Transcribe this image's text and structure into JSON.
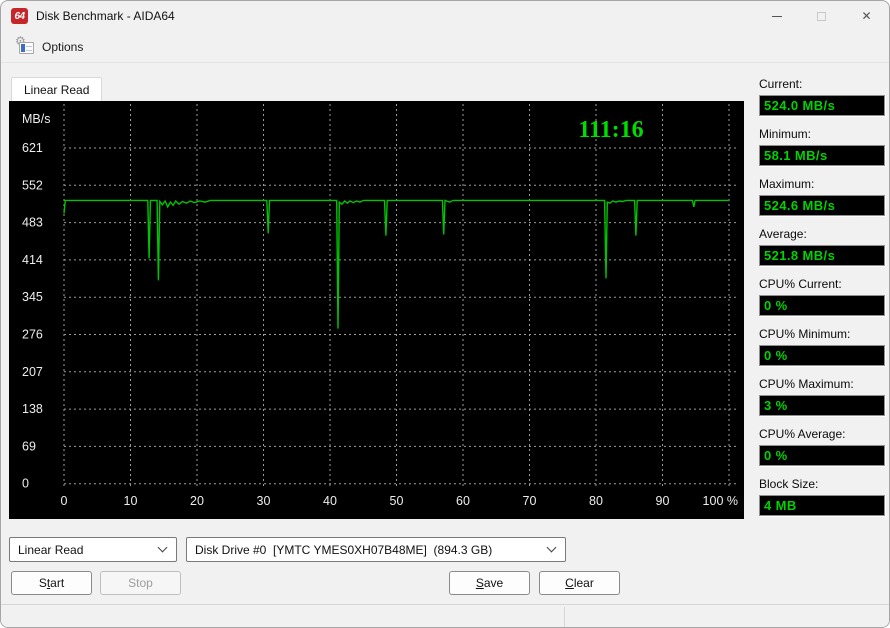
{
  "window": {
    "title": "Disk Benchmark - AIDA64",
    "app_icon_text": "64",
    "close_glyph": "✕"
  },
  "icons": {
    "app-icon": "red rounded square with 64",
    "options-icon": "gear over checklist sheet",
    "minimize-icon": "css-line",
    "maximize-icon": "css-square-disabled",
    "close-icon": "✕",
    "chevron-down-icon": "css-chevron"
  },
  "menu": {
    "options_label": "Options"
  },
  "tabs": {
    "linear_read_label": "Linear Read"
  },
  "chart_data": {
    "type": "line",
    "title": "",
    "timer": "111:16",
    "ylabel": "MB/s",
    "xlabel": "%",
    "ylim": [
      0,
      690
    ],
    "xlim": [
      0,
      100
    ],
    "grid": true,
    "background": "#000000",
    "grid_color": "#9b9b9b",
    "line_color": "#00c400",
    "timer_color": "#00dd00",
    "label_color": "#ededed",
    "y_ticks": [
      621,
      552,
      483,
      414,
      345,
      276,
      207,
      138,
      69,
      0
    ],
    "x_tick_pcts": [
      0,
      10,
      20,
      30,
      40,
      50,
      60,
      70,
      80,
      90,
      100
    ],
    "x_tick_labels": [
      "0",
      "10",
      "20",
      "30",
      "40",
      "50",
      "60",
      "70",
      "80",
      "90",
      "100 %"
    ],
    "series": [
      {
        "name": "Linear Read MB/s",
        "points": [
          [
            0,
            500
          ],
          [
            0.2,
            524
          ],
          [
            12.6,
            524
          ],
          [
            12.8,
            417
          ],
          [
            13.0,
            524
          ],
          [
            14.0,
            524
          ],
          [
            14.2,
            376
          ],
          [
            14.4,
            522
          ],
          [
            14.8,
            516
          ],
          [
            15.2,
            523
          ],
          [
            15.6,
            512
          ],
          [
            16.0,
            521
          ],
          [
            16.4,
            515
          ],
          [
            16.8,
            523
          ],
          [
            17.3,
            517
          ],
          [
            17.8,
            522
          ],
          [
            18.4,
            519
          ],
          [
            19.0,
            523
          ],
          [
            19.6,
            520
          ],
          [
            20.4,
            523
          ],
          [
            21.2,
            521
          ],
          [
            22.0,
            524
          ],
          [
            30.5,
            524
          ],
          [
            30.7,
            463
          ],
          [
            30.9,
            524
          ],
          [
            41.0,
            524
          ],
          [
            41.2,
            287
          ],
          [
            41.4,
            521
          ],
          [
            41.8,
            517
          ],
          [
            42.2,
            523
          ],
          [
            42.6,
            519
          ],
          [
            43.0,
            523
          ],
          [
            43.5,
            520
          ],
          [
            44.0,
            523
          ],
          [
            44.5,
            521
          ],
          [
            45.0,
            524
          ],
          [
            48.2,
            524
          ],
          [
            48.4,
            459
          ],
          [
            48.6,
            524
          ],
          [
            56.9,
            524
          ],
          [
            57.1,
            461
          ],
          [
            57.3,
            524
          ],
          [
            58.0,
            521
          ],
          [
            58.5,
            524
          ],
          [
            81.3,
            524
          ],
          [
            81.5,
            380
          ],
          [
            81.7,
            521
          ],
          [
            82.1,
            519
          ],
          [
            82.5,
            523
          ],
          [
            83.0,
            521
          ],
          [
            83.5,
            523
          ],
          [
            84.0,
            522
          ],
          [
            84.5,
            524
          ],
          [
            85.8,
            524
          ],
          [
            86.0,
            459
          ],
          [
            86.2,
            524
          ],
          [
            94.5,
            524
          ],
          [
            94.7,
            512
          ],
          [
            94.9,
            524
          ],
          [
            100,
            524
          ]
        ]
      }
    ]
  },
  "stats": {
    "items": [
      {
        "label": "Current:",
        "value": "524.0 MB/s"
      },
      {
        "label": "Minimum:",
        "value": "58.1 MB/s"
      },
      {
        "label": "Maximum:",
        "value": "524.6 MB/s"
      },
      {
        "label": "Average:",
        "value": "521.8 MB/s"
      },
      {
        "label": "CPU% Current:",
        "value": "0 %"
      },
      {
        "label": "CPU% Minimum:",
        "value": "0 %"
      },
      {
        "label": "CPU% Maximum:",
        "value": "3 %"
      },
      {
        "label": "CPU% Average:",
        "value": "0 %"
      },
      {
        "label": "Block Size:",
        "value": "4 MB"
      }
    ]
  },
  "controls": {
    "benchmark_select_value": "Linear Read",
    "drive_select_value": "Disk Drive #0  [YMTC YMES0XH07B48ME]  (894.3 GB)",
    "start": {
      "pre": "S",
      "key": "t",
      "post": "art"
    },
    "stop_label": "Stop",
    "save": {
      "pre": "",
      "key": "S",
      "post": "ave"
    },
    "clear": {
      "pre": "",
      "key": "C",
      "post": "lear"
    }
  },
  "colors": {
    "value_green": "#00d300",
    "chart_line_green": "#00c400",
    "app_icon_red": "#c5262c",
    "window_bg": "#f1f1f1"
  }
}
